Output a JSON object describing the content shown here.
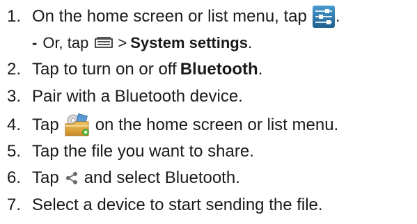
{
  "steps": [
    {
      "num": "1.",
      "text_a": "On the home screen or list menu, tap",
      "text_b": ".",
      "icon": "settings-sliders-icon",
      "sub": {
        "dash": "-",
        "text_a": "Or, tap",
        "icon": "menu-key-icon",
        "text_b": ">",
        "bold": "System settings",
        "text_c": "."
      }
    },
    {
      "num": "2.",
      "text_a": "Tap to turn on or off",
      "bold": "Bluetooth",
      "text_b": "."
    },
    {
      "num": "3.",
      "text_a": "Pair with a Bluetooth device."
    },
    {
      "num": "4.",
      "text_a": "Tap",
      "icon": "file-manager-folder-icon",
      "text_b": "on the home screen or list menu."
    },
    {
      "num": "5.",
      "text_a": "Tap the file you want to share."
    },
    {
      "num": "6.",
      "text_a": "Tap",
      "icon": "share-icon",
      "text_b": "and select Bluetooth."
    },
    {
      "num": "7.",
      "text_a": "Select a device to start sending the file."
    }
  ],
  "colors": {
    "text": "#1a1a1a",
    "settings_icon_bg": "#2f7fb5",
    "folder_icon": "#e0a83a"
  }
}
